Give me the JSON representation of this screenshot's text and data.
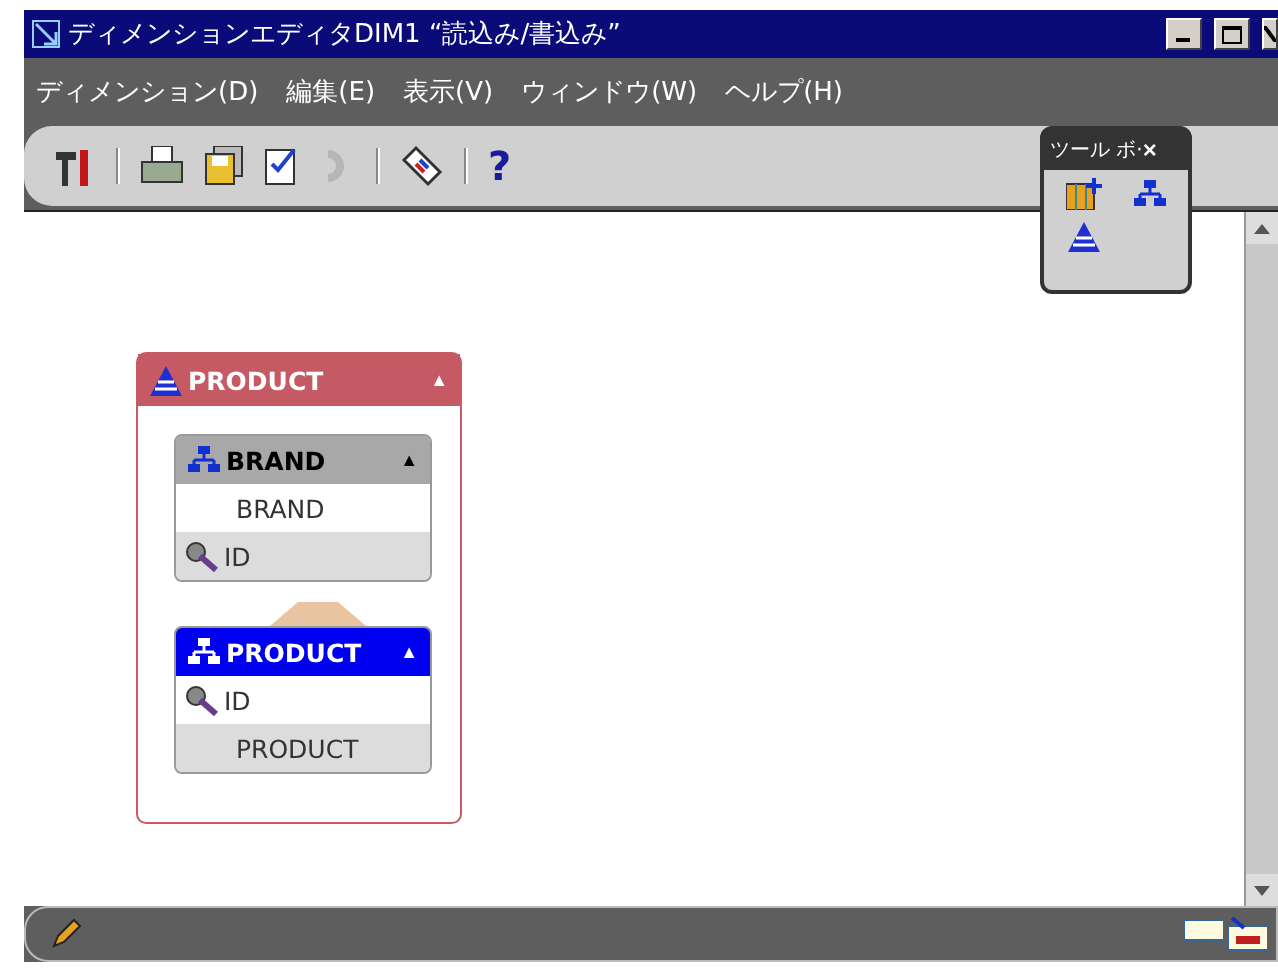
{
  "window": {
    "title": "ディメンションエディタDIM1 “読込み/書込み”"
  },
  "menu": [
    {
      "label": "ディメンション(D)"
    },
    {
      "label": "編集(E)"
    },
    {
      "label": "表示(V)"
    },
    {
      "label": "ウィンドウ(W)"
    },
    {
      "label": "ヘルプ(H)"
    }
  ],
  "toolbar": [
    {
      "kind": "tool",
      "disabled": false
    },
    {
      "kind": "separator"
    },
    {
      "kind": "print",
      "disabled": false
    },
    {
      "kind": "save",
      "disabled": false
    },
    {
      "kind": "properties",
      "disabled": false
    },
    {
      "kind": "undo",
      "disabled": true
    },
    {
      "kind": "separator"
    },
    {
      "kind": "tag",
      "disabled": false
    },
    {
      "kind": "separator"
    },
    {
      "kind": "help",
      "label": "?",
      "disabled": false
    }
  ],
  "toolbox": {
    "title": "ツール ボ·",
    "close": "×",
    "tools": [
      {
        "kind": "table"
      },
      {
        "kind": "hierarchy"
      },
      {
        "kind": "dimension"
      }
    ]
  },
  "dimension": {
    "name": "PRODUCT",
    "collapse": "▲",
    "levels": [
      {
        "name": "BRAND",
        "selected": false,
        "collapse": "▲",
        "attributes": [
          {
            "label": "BRAND",
            "key": false
          },
          {
            "label": "ID",
            "key": true
          }
        ]
      },
      {
        "name": "PRODUCT",
        "selected": true,
        "collapse": "▲",
        "attributes": [
          {
            "label": "ID",
            "key": true
          },
          {
            "label": "PRODUCT",
            "key": false
          }
        ]
      }
    ]
  }
}
